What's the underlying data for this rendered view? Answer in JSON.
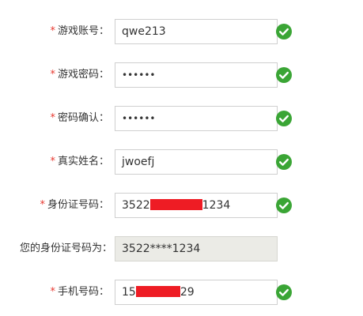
{
  "form": {
    "required_mark": "*",
    "rows": [
      {
        "label": "游戏账号：",
        "value": "qwe213",
        "required": true,
        "valid": true
      },
      {
        "label": "游戏密码：",
        "value": "••••••",
        "required": true,
        "valid": true
      },
      {
        "label": "密码确认：",
        "value": "••••••",
        "required": true,
        "valid": true
      },
      {
        "label": "真实姓名：",
        "value": "jwoefj",
        "required": true,
        "valid": true
      },
      {
        "label": "身份证号码：",
        "value_prefix": "3522",
        "value_suffix": "1234",
        "required": true,
        "valid": true
      },
      {
        "label": "您的身份证号码为：",
        "value": "3522****1234",
        "required": false,
        "valid": false
      },
      {
        "label": "手机号码：",
        "value_prefix": "15",
        "value_suffix": "29",
        "required": true,
        "valid": true
      }
    ],
    "icons": {
      "valid": "check-circle-icon"
    },
    "colors": {
      "required": "#e8382f",
      "valid": "#3aa535",
      "redaction": "#ee1c24",
      "readonly_bg": "#ebebe6"
    }
  }
}
